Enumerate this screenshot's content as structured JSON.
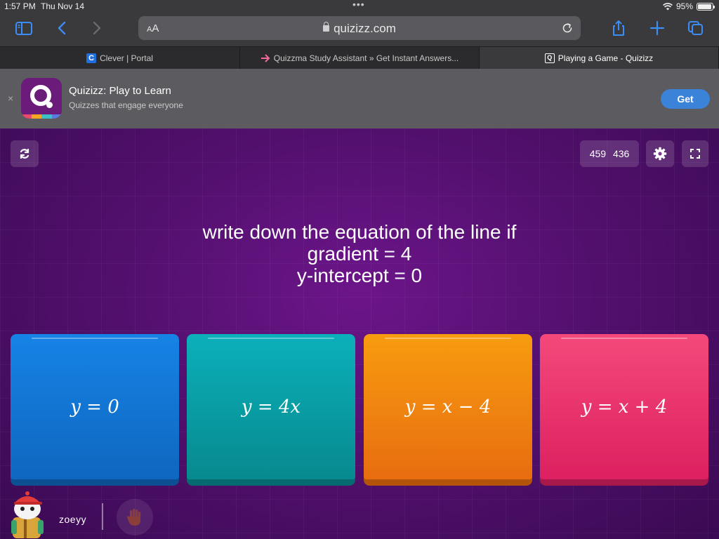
{
  "status": {
    "time": "1:57 PM",
    "date": "Thu Nov 14",
    "battery": "95%",
    "battery_level": 0.95
  },
  "toolbar": {
    "text_size_label_small": "A",
    "text_size_label_large": "A",
    "url": "quizizz.com"
  },
  "tabs": [
    {
      "label": "Clever | Portal",
      "favicon": "C"
    },
    {
      "label": "Quizzma Study Assistant » Get Instant Answers...",
      "favicon": "arrow-icon"
    },
    {
      "label": "Playing a Game - Quizizz",
      "favicon": "Q"
    }
  ],
  "banner": {
    "app_name": "Quizizz: Play to Learn",
    "tagline": "Quizzes that engage everyone",
    "get_label": "Get"
  },
  "game": {
    "score_a": "459",
    "score_b": "436",
    "question_lines": [
      "write down the equation of the line if",
      "gradient = 4",
      "y-intercept = 0"
    ],
    "options": [
      {
        "label": "y = 0",
        "color": "#1a7fe0"
      },
      {
        "label": "y = 4x",
        "color": "#0aa3ad"
      },
      {
        "label": "y = x − 4",
        "color": "#f28a10"
      },
      {
        "label": "y = x + 4",
        "color": "#e83d6b"
      }
    ],
    "player_name": "zoeyy"
  },
  "colors": {
    "accent": "#3b8df7",
    "game_bg": "#53106e",
    "brand": "#6b1b7a"
  }
}
